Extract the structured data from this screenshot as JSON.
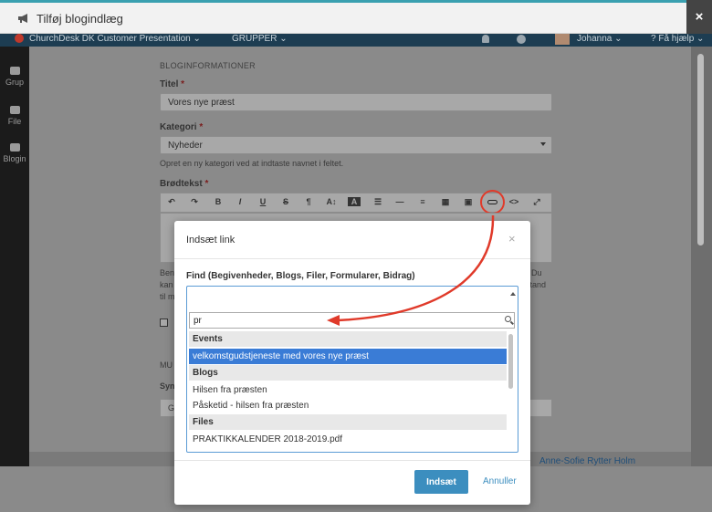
{
  "outer_modal": {
    "title": "Tilføj blogindlæg",
    "close_label": "×",
    "icon": "megaphone-icon"
  },
  "app_topbar": {
    "org": "ChurchDesk DK Customer Presentation",
    "groups": "GRUPPER",
    "user": "Johanna",
    "help": "Få hjælp"
  },
  "sidebar": {
    "items": [
      {
        "label": "Grup",
        "icon": "users-icon"
      },
      {
        "label": "File",
        "icon": "folder-icon"
      },
      {
        "label": "Blogin",
        "icon": "megaphone-icon"
      }
    ]
  },
  "editor": {
    "section": "BLOGINFORMATIONER",
    "title_label": "Titel",
    "title_value": "Vores nye præst",
    "category_label": "Kategori",
    "category_value": "Nyheder",
    "category_hint": "Opret en ny kategori ved at indtaste navnet i feltet.",
    "body_label": "Brødtekst",
    "required_mark": "*",
    "toolbar": [
      "↶",
      "↷",
      "B",
      "I",
      "U",
      "S",
      "¶",
      "A↕",
      "A",
      "☰",
      "—",
      "≡",
      "▦",
      "▣",
      "⛓",
      "<>",
      "⤢"
    ],
    "fragments_left": [
      "Ben",
      "kan",
      "til m"
    ],
    "fragments_right": [
      "Du",
      "stand"
    ],
    "lower_left": [
      "MU",
      "Syn",
      "G"
    ],
    "bg_name": "Anne-Sofie Rytter Holm"
  },
  "link_dialog": {
    "title": "Indsæt link",
    "close_label": "×",
    "find_label": "Find (Begivenheder, Blogs, Filer, Formularer, Bidrag)",
    "search_value": "pr",
    "groups": [
      {
        "name": "Events",
        "options": [
          "velkomstgudstjeneste med vores nye præst"
        ]
      },
      {
        "name": "Blogs",
        "options": [
          "Hilsen fra præsten",
          "Påsketid - hilsen fra præsten"
        ]
      },
      {
        "name": "Files",
        "options": [
          "PRAKTIKKALENDER 2018-2019.pdf"
        ]
      }
    ],
    "selected_option": "velkomstgudstjeneste med vores nye præst",
    "insert_label": "Indsæt",
    "cancel_label": "Annuller"
  },
  "colors": {
    "accent": "#3c8ebf",
    "selected": "#3a7cd6",
    "annotation": "#e03a2a"
  }
}
